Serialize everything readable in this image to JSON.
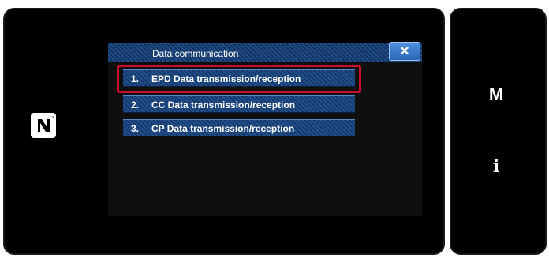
{
  "dialog": {
    "title": "Data communication",
    "close_icon": "×",
    "items": [
      {
        "num": "1.",
        "label": "EPD Data transmission/reception"
      },
      {
        "num": "2.",
        "label": "CC Data transmission/reception"
      },
      {
        "num": "3.",
        "label": "CP Data transmission/reception"
      }
    ]
  },
  "side": {
    "m_label": "M",
    "info_label": "i"
  },
  "colors": {
    "selection": "#c8102e",
    "accent": "#1f4d8a"
  }
}
